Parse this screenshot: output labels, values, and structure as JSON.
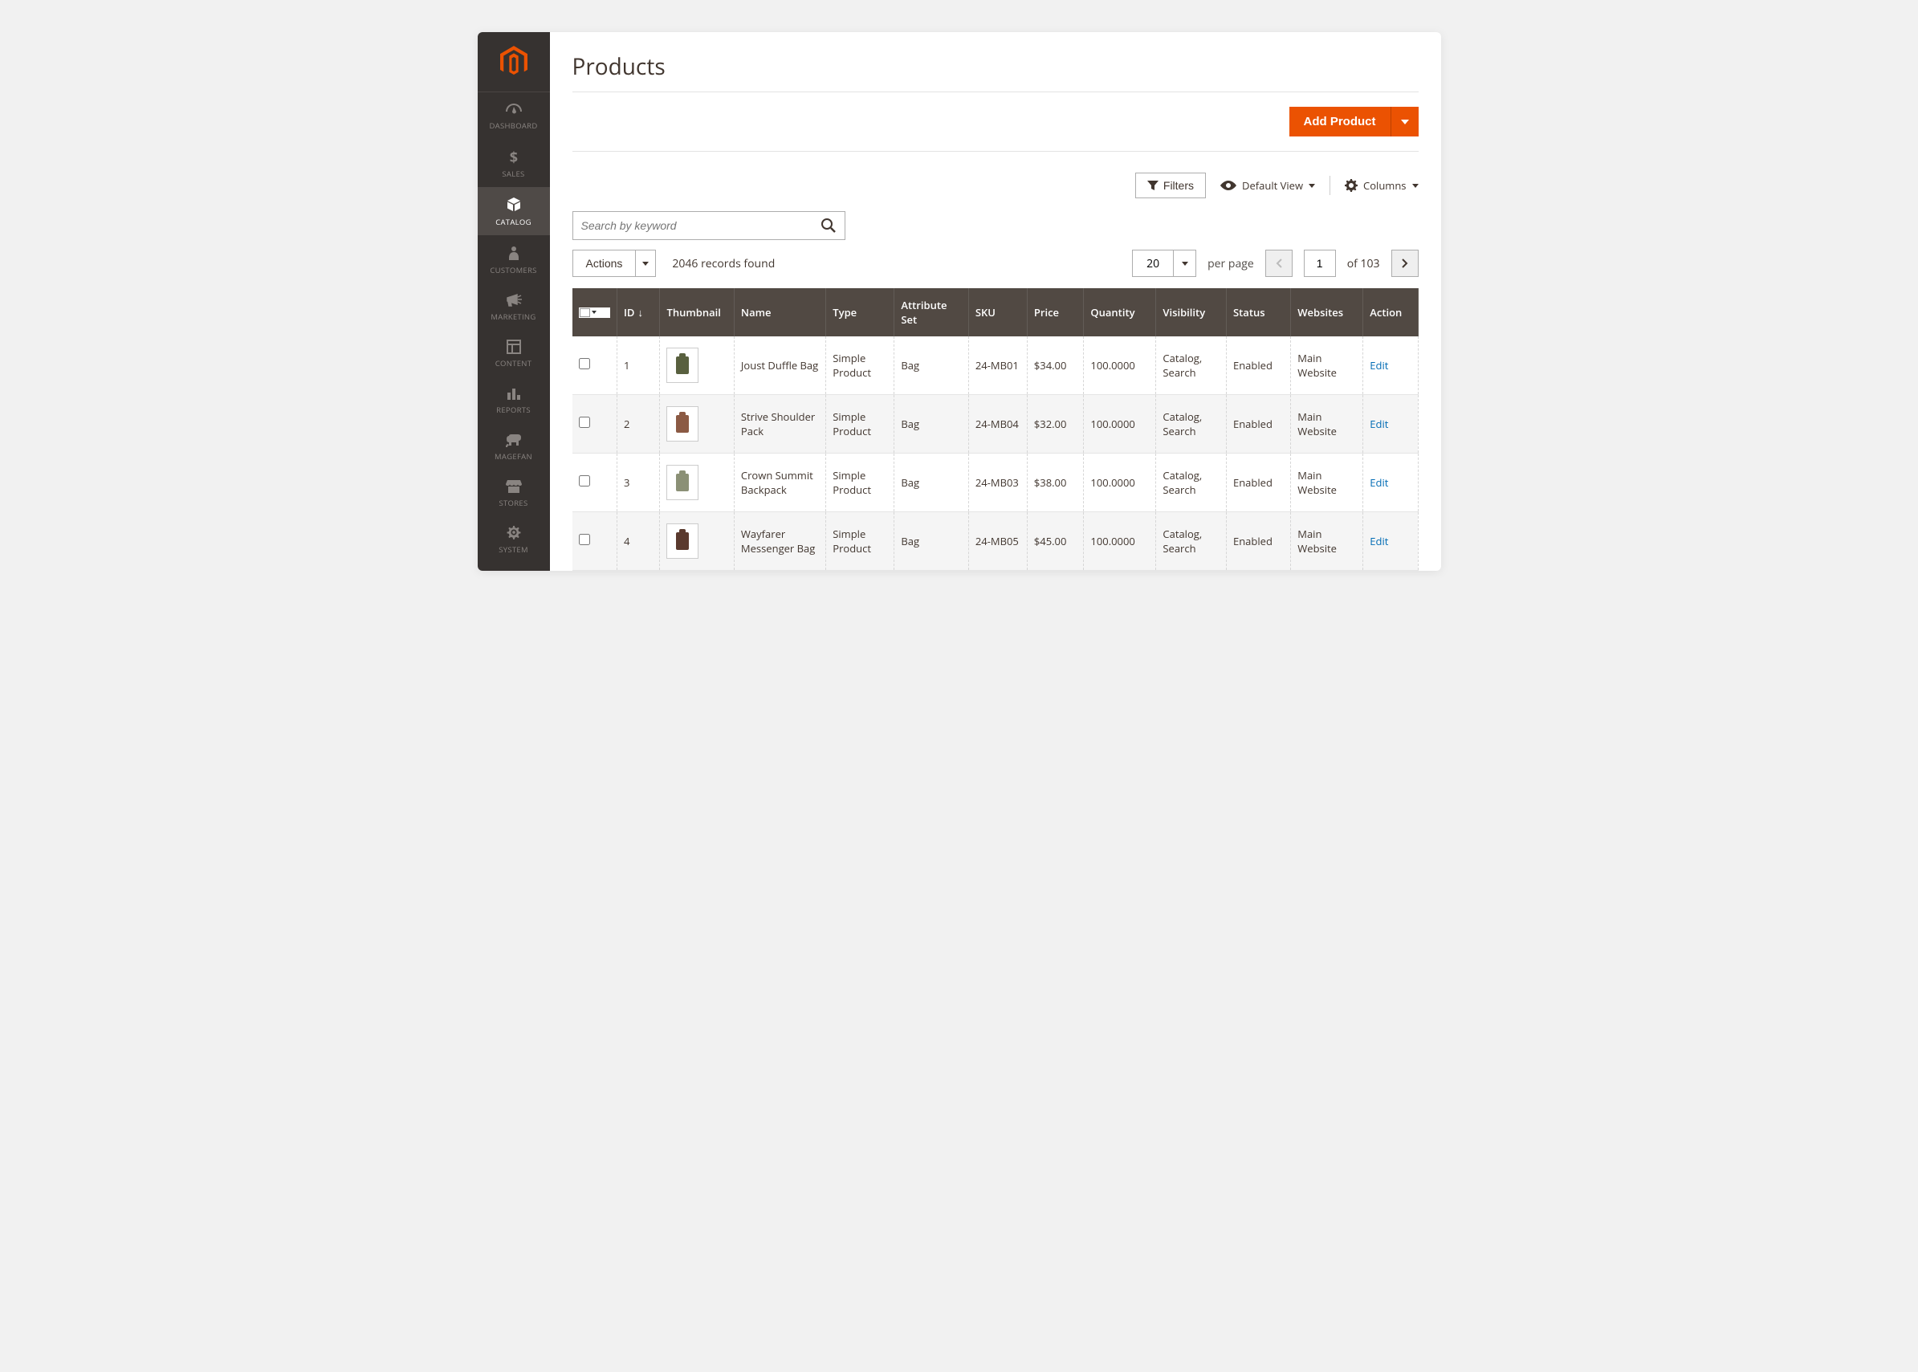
{
  "sidebar": {
    "items": [
      {
        "label": "DASHBOARD"
      },
      {
        "label": "SALES"
      },
      {
        "label": "CATALOG"
      },
      {
        "label": "CUSTOMERS"
      },
      {
        "label": "MARKETING"
      },
      {
        "label": "CONTENT"
      },
      {
        "label": "REPORTS"
      },
      {
        "label": "MAGEFAN"
      },
      {
        "label": "STORES"
      },
      {
        "label": "SYSTEM"
      }
    ]
  },
  "page": {
    "title": "Products"
  },
  "header": {
    "add_product": "Add Product"
  },
  "toolbar": {
    "filters": "Filters",
    "default_view": "Default View",
    "columns": "Columns"
  },
  "search": {
    "placeholder": "Search by keyword"
  },
  "actions": {
    "label": "Actions"
  },
  "records": {
    "text": "2046 records found"
  },
  "pager": {
    "page_size": "20",
    "per_page": "per page",
    "current": "1",
    "of_text": "of 103"
  },
  "table": {
    "headers": {
      "id": "ID",
      "thumbnail": "Thumbnail",
      "name": "Name",
      "type": "Type",
      "attribute_set": "Attribute Set",
      "sku": "SKU",
      "price": "Price",
      "quantity": "Quantity",
      "visibility": "Visibility",
      "status": "Status",
      "websites": "Websites",
      "action": "Action"
    },
    "rows": [
      {
        "id": "1",
        "name": "Joust Duffle Bag",
        "type": "Simple Product",
        "attr": "Bag",
        "sku": "24-MB01",
        "price": "$34.00",
        "qty": "100.0000",
        "visibility": "Catalog, Search",
        "status": "Enabled",
        "websites": "Main Website",
        "action": "Edit",
        "thumb_color": "#59603f"
      },
      {
        "id": "2",
        "name": "Strive Shoulder Pack",
        "type": "Simple Product",
        "attr": "Bag",
        "sku": "24-MB04",
        "price": "$32.00",
        "qty": "100.0000",
        "visibility": "Catalog, Search",
        "status": "Enabled",
        "websites": "Main Website",
        "action": "Edit",
        "thumb_color": "#8b5a44"
      },
      {
        "id": "3",
        "name": "Crown Summit Backpack",
        "type": "Simple Product",
        "attr": "Bag",
        "sku": "24-MB03",
        "price": "$38.00",
        "qty": "100.0000",
        "visibility": "Catalog, Search",
        "status": "Enabled",
        "websites": "Main Website",
        "action": "Edit",
        "thumb_color": "#8b9076"
      },
      {
        "id": "4",
        "name": "Wayfarer Messenger Bag",
        "type": "Simple Product",
        "attr": "Bag",
        "sku": "24-MB05",
        "price": "$45.00",
        "qty": "100.0000",
        "visibility": "Catalog, Search",
        "status": "Enabled",
        "websites": "Main Website",
        "action": "Edit",
        "thumb_color": "#5a3a2e"
      }
    ]
  }
}
